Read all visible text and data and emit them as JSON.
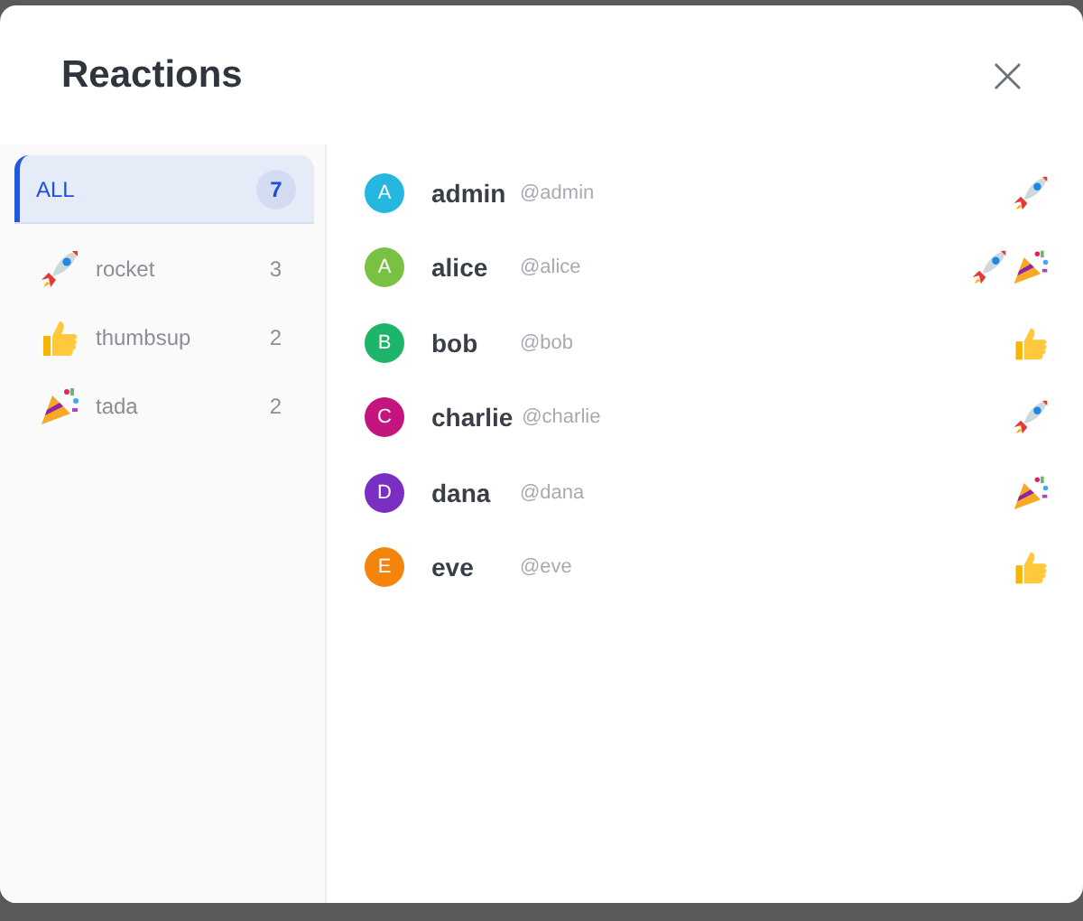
{
  "dialog": {
    "title": "Reactions",
    "close_label": "×"
  },
  "filters": [
    {
      "kind": "all",
      "label": "ALL",
      "count": "7",
      "selected": true
    },
    {
      "kind": "rocket",
      "label": "rocket",
      "count": "3",
      "selected": false
    },
    {
      "kind": "thumbsup",
      "label": "thumbsup",
      "count": "2",
      "selected": false
    },
    {
      "kind": "tada",
      "label": "tada",
      "count": "2",
      "selected": false
    }
  ],
  "users": [
    {
      "initial": "A",
      "color": "#25b7e0",
      "name": "admin",
      "handle": "@admin",
      "reactions": [
        {
          "kind": "rocket"
        }
      ]
    },
    {
      "initial": "A",
      "color": "#7ac143",
      "name": "alice",
      "handle": "@alice",
      "reactions": [
        {
          "kind": "rocket"
        },
        {
          "kind": "tada"
        }
      ]
    },
    {
      "initial": "B",
      "color": "#1db56a",
      "name": "bob",
      "handle": "@bob",
      "reactions": [
        {
          "kind": "thumbsup"
        }
      ]
    },
    {
      "initial": "C",
      "color": "#c4157e",
      "name": "charlie",
      "handle": "@charlie",
      "reactions": [
        {
          "kind": "rocket"
        }
      ]
    },
    {
      "initial": "D",
      "color": "#7b2fc2",
      "name": "dana",
      "handle": "@dana",
      "reactions": [
        {
          "kind": "tada"
        }
      ]
    },
    {
      "initial": "E",
      "color": "#f5840c",
      "name": "eve",
      "handle": "@eve",
      "reactions": [
        {
          "kind": "thumbsup"
        }
      ]
    }
  ]
}
